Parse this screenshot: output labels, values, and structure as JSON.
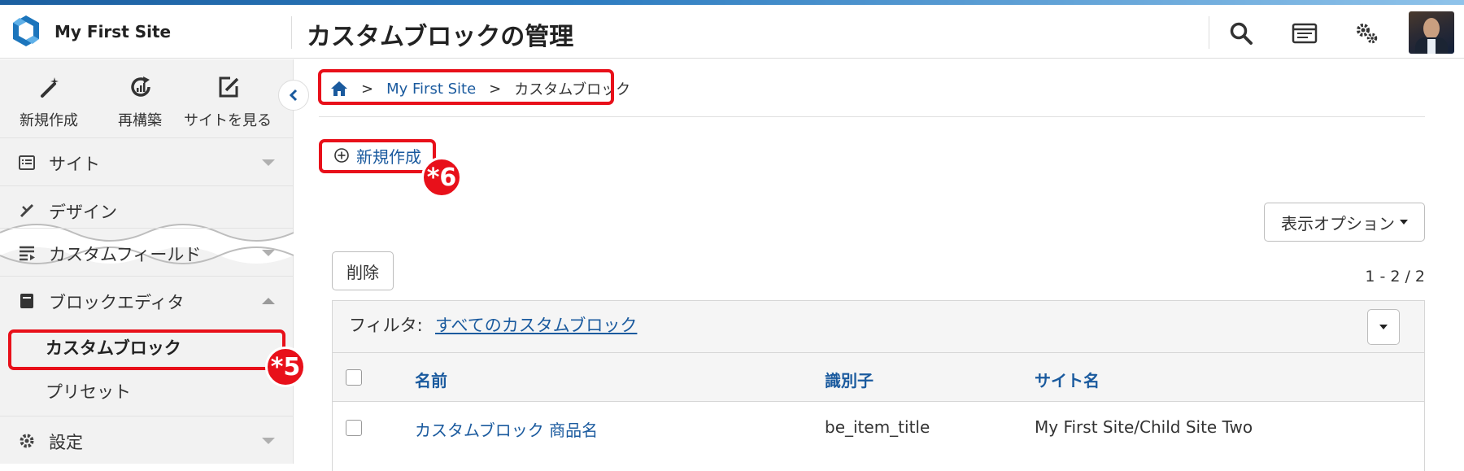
{
  "header": {
    "site_name": "My First Site",
    "page_title": "カスタムブロックの管理",
    "icons": [
      "search-icon",
      "dashboard-icon",
      "gears-icon",
      "user-avatar"
    ]
  },
  "sidebar": {
    "quick_actions": [
      {
        "label": "新規作成",
        "icon": "pen-icon"
      },
      {
        "label": "再構築",
        "icon": "rebuild-icon"
      },
      {
        "label": "サイトを見る",
        "icon": "external-edit-icon"
      }
    ],
    "items": [
      {
        "label": "サイト",
        "icon": "site-list-icon"
      },
      {
        "label": "デザイン",
        "icon": "design-icon"
      },
      {
        "label": "カスタムフィールド",
        "icon": "custom-field-icon"
      },
      {
        "label": "ブロックエディタ",
        "icon": "block-editor-icon"
      },
      {
        "label": "設定",
        "icon": "gear-icon"
      }
    ],
    "subitems": [
      {
        "label": "カスタムブロック",
        "active": true
      },
      {
        "label": "プリセット",
        "active": false
      }
    ]
  },
  "breadcrumb": {
    "home_icon": "home-icon",
    "separator": ">",
    "site": "My First Site",
    "current": "カスタムブロック"
  },
  "actions": {
    "new_label": "新規作成",
    "display_options": "表示オプション",
    "delete": "削除",
    "pagination": "1 - 2 / 2"
  },
  "annotations": {
    "badge_5": "*5",
    "badge_6": "*6",
    "highlight_color": "#e8101a"
  },
  "filter": {
    "label": "フィルタ:",
    "value": "すべてのカスタムブロック"
  },
  "table": {
    "columns": [
      "名前",
      "識別子",
      "サイト名"
    ],
    "rows": [
      {
        "name": "カスタムブロック 商品名",
        "identifier": "be_item_title",
        "site": "My First Site/Child Site Two"
      }
    ]
  },
  "colors": {
    "accent": "#1a5a9e",
    "annotation_red": "#e8101a",
    "sidebar_bg": "#f2f2f2"
  }
}
